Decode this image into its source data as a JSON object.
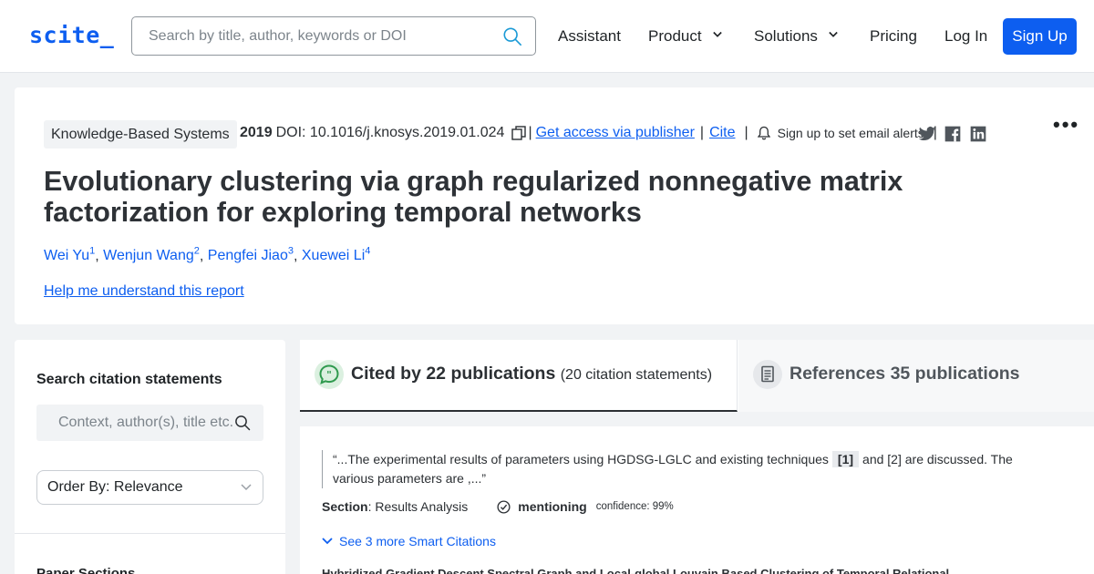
{
  "header": {
    "logo": "scite_",
    "search_placeholder": "Search by title, author, keywords or DOI",
    "nav": {
      "assistant": "Assistant",
      "product": "Product",
      "solutions": "Solutions",
      "pricing": "Pricing",
      "login": "Log In",
      "signup": "Sign Up"
    }
  },
  "paper": {
    "journal": "Knowledge-Based Systems",
    "year": "2019",
    "doi": "DOI: 10.1016/j.knosys.2019.01.024",
    "access_link": "Get access via publisher",
    "cite_link": "Cite",
    "alert_text": "Sign up to set email alerts",
    "separator": "|",
    "more": "•••",
    "title": "Evolutionary clustering via graph regularized nonnegative matrix factorization for exploring temporal networks",
    "authors": [
      {
        "name": "Wei Yu",
        "sup": "1"
      },
      {
        "name": "Wenjun Wang",
        "sup": "2"
      },
      {
        "name": "Pengfei Jiao",
        "sup": "3"
      },
      {
        "name": "Xuewei Li",
        "sup": "4"
      }
    ],
    "comma": ",",
    "help_link": "Help me understand this report"
  },
  "sidebar": {
    "search_heading": "Search citation statements",
    "search_placeholder": "Context, author(s), title etc.",
    "order_by": "Order By: Relevance",
    "paper_sections": "Paper Sections"
  },
  "tabs": {
    "cited_by": "Cited by 22 publications",
    "cited_by_sub": "(20 citation statements)",
    "references": "References 35 publications"
  },
  "citation": {
    "quote_before": "“...The experimental results of parameters using HGDSG-LGLC and existing techniques",
    "ref_chip": "[1]",
    "quote_after": "and [2] are discussed. The various parameters are ,...”",
    "section_label": "Section",
    "section_value": ": Results Analysis",
    "type": "mentioning",
    "confidence": "confidence: 99%",
    "more_link": "See 3 more Smart Citations",
    "next_title": "Hybridized Gradient Descent Spectral Graph and Local-global Louvain Based Clustering of Temporal Relational"
  },
  "icons": {
    "search": "search-icon",
    "copy": "copy-icon",
    "bell": "bell-icon",
    "twitter": "twitter-icon",
    "facebook": "facebook-icon",
    "linkedin": "linkedin-icon",
    "quote": "quote-bubble-icon",
    "document": "document-icon",
    "check": "check-circle-icon",
    "chevron": "chevron-down-icon"
  },
  "colors": {
    "brand": "#0d5ef0",
    "text": "#2b2f33",
    "background": "#f1f3f5",
    "cited_icon_bg": "#dbf0e0"
  }
}
